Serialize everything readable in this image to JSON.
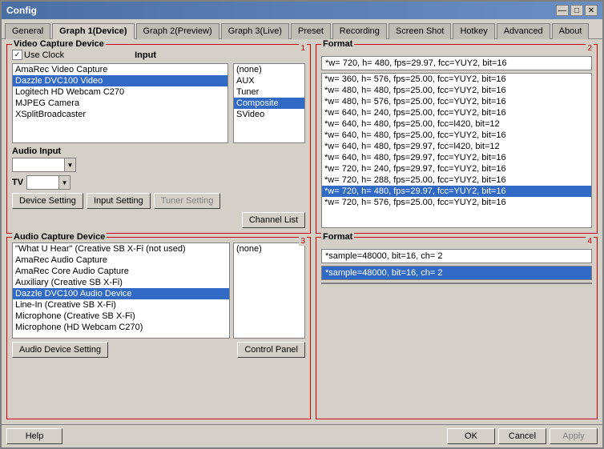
{
  "window": {
    "title": "Config"
  },
  "title_controls": {
    "minimize": "—",
    "maximize": "□",
    "close": "✕"
  },
  "tabs": [
    {
      "id": "general",
      "label": "General"
    },
    {
      "id": "graph1",
      "label": "Graph 1(Device)",
      "active": true
    },
    {
      "id": "graph2",
      "label": "Graph 2(Preview)"
    },
    {
      "id": "graph3",
      "label": "Graph 3(Live)"
    },
    {
      "id": "preset",
      "label": "Preset"
    },
    {
      "id": "recording",
      "label": "Recording"
    },
    {
      "id": "screenshot",
      "label": "Screen Shot"
    },
    {
      "id": "hotkey",
      "label": "Hotkey"
    },
    {
      "id": "advanced",
      "label": "Advanced"
    },
    {
      "id": "about",
      "label": "About"
    }
  ],
  "panel1": {
    "title": "Video Capture Device",
    "use_clock_label": "Use Clock",
    "input_label": "Input",
    "num": "1",
    "devices": [
      "AmaRec Video Capture",
      "Dazzle DVC100 Video",
      "Logitech HD Webcam C270",
      "MJPEG Camera",
      "XSplitBroadcaster"
    ],
    "selected_device": 1,
    "inputs": [
      "(none)",
      "AUX",
      "Tuner",
      "Composite",
      "SVideo"
    ],
    "selected_input": 3,
    "audio_input_label": "Audio Input",
    "tv_label": "TV",
    "buttons": {
      "device_setting": "Device Setting",
      "input_setting": "Input Setting",
      "tuner_setting": "Tuner Setting"
    },
    "channel_list_btn": "Channel List"
  },
  "panel2": {
    "title": "Format",
    "num": "2",
    "header": "*w= 720, h= 480, fps=29.97, fcc=YUY2, bit=16",
    "formats": [
      "*w= 360, h= 576, fps=25.00, fcc=YUY2, bit=16",
      "*w= 480, h= 480, fps=25.00, fcc=YUY2, bit=16",
      "*w= 480, h= 576, fps=25.00, fcc=YUY2, bit=16",
      "*w= 640, h= 240, fps=25.00, fcc=YUY2, bit=16",
      "*w= 640, h= 480, fps=25.00, fcc=l420, bit=12",
      "*w= 640, h= 480, fps=25.00, fcc=YUY2, bit=16",
      "*w= 640, h= 480, fps=29.97, fcc=l420, bit=12",
      "*w= 640, h= 480, fps=29.97, fcc=YUY2, bit=16",
      "*w= 720, h= 240, fps=29.97, fcc=YUY2, bit=16",
      "*w= 720, h= 288, fps=25.00, fcc=YUY2, bit=16",
      "*w= 720, h= 480, fps=29.97, fcc=YUY2, bit=16",
      "*w= 720, h= 576, fps=25.00, fcc=YUY2, bit=16"
    ],
    "selected_format": 10
  },
  "panel3": {
    "title": "Audio Capture Device",
    "num": "3",
    "devices": [
      "\"What U Hear\" (Creative SB X-Fi (not used)",
      "AmaRec Audio Capture",
      "AmaRec Core Audio Capture",
      "Auxiliary (Creative SB X-Fi)",
      "Dazzle DVC100 Audio Device",
      "Line-In (Creative SB X-Fi)",
      "Microphone (Creative SB X-Fi)",
      "Microphone (HD Webcam C270)"
    ],
    "selected_device": 4,
    "audio_inputs": [
      "(none)"
    ],
    "buttons": {
      "device_setting": "Audio Device Setting",
      "control_panel": "Control Panel"
    }
  },
  "panel4": {
    "title": "Format",
    "num": "4",
    "header": "*sample=48000, bit=16, ch= 2",
    "selected_format": "*sample=48000, bit=16, ch= 2",
    "formats": [
      "*sample=48000, bit=16, ch= 2"
    ]
  },
  "footer": {
    "help": "Help",
    "ok": "OK",
    "cancel": "Cancel",
    "apply": "Apply"
  }
}
